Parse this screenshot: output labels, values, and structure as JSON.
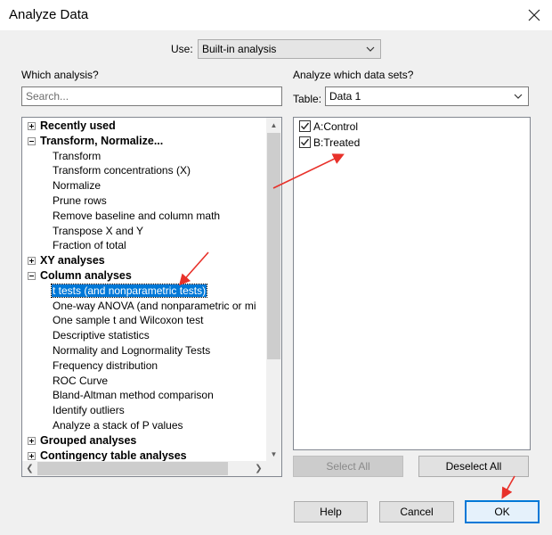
{
  "dialog": {
    "title": "Analyze Data"
  },
  "use": {
    "label": "Use:",
    "value": "Built-in analysis"
  },
  "left": {
    "heading": "Which analysis?",
    "search_placeholder": "Search...",
    "tree": [
      {
        "label": "Recently used",
        "kind": "category",
        "expanded": false
      },
      {
        "label": "Transform, Normalize...",
        "kind": "category",
        "expanded": true
      },
      {
        "label": "Transform",
        "kind": "item"
      },
      {
        "label": "Transform concentrations (X)",
        "kind": "item"
      },
      {
        "label": "Normalize",
        "kind": "item"
      },
      {
        "label": "Prune rows",
        "kind": "item"
      },
      {
        "label": "Remove baseline and column math",
        "kind": "item"
      },
      {
        "label": "Transpose X and Y",
        "kind": "item"
      },
      {
        "label": "Fraction of total",
        "kind": "item"
      },
      {
        "label": "XY analyses",
        "kind": "category",
        "expanded": false
      },
      {
        "label": "Column analyses",
        "kind": "category",
        "expanded": true
      },
      {
        "label": "t tests (and nonparametric tests)",
        "kind": "item",
        "selected": true
      },
      {
        "label": "One-way ANOVA (and nonparametric or mi",
        "kind": "item"
      },
      {
        "label": "One sample t and Wilcoxon test",
        "kind": "item"
      },
      {
        "label": "Descriptive statistics",
        "kind": "item"
      },
      {
        "label": "Normality and Lognormality Tests",
        "kind": "item"
      },
      {
        "label": "Frequency distribution",
        "kind": "item"
      },
      {
        "label": "ROC Curve",
        "kind": "item"
      },
      {
        "label": "Bland-Altman method comparison",
        "kind": "item"
      },
      {
        "label": "Identify outliers",
        "kind": "item"
      },
      {
        "label": "Analyze a stack of P values",
        "kind": "item"
      },
      {
        "label": "Grouped analyses",
        "kind": "category",
        "expanded": false
      },
      {
        "label": "Contingency table analyses",
        "kind": "category",
        "expanded": false
      }
    ]
  },
  "right": {
    "heading": "Analyze which data sets?",
    "table_label": "Table:",
    "table_value": "Data 1",
    "datasets": [
      {
        "label": "A:Control",
        "checked": true
      },
      {
        "label": "B:Treated",
        "checked": true
      }
    ],
    "select_all": "Select All",
    "deselect_all": "Deselect All"
  },
  "buttons": {
    "help": "Help",
    "cancel": "Cancel",
    "ok": "OK"
  },
  "colors": {
    "selection": "#0078d7",
    "annotation_arrow": "#e8312a",
    "default_button_border": "#0078d7"
  }
}
